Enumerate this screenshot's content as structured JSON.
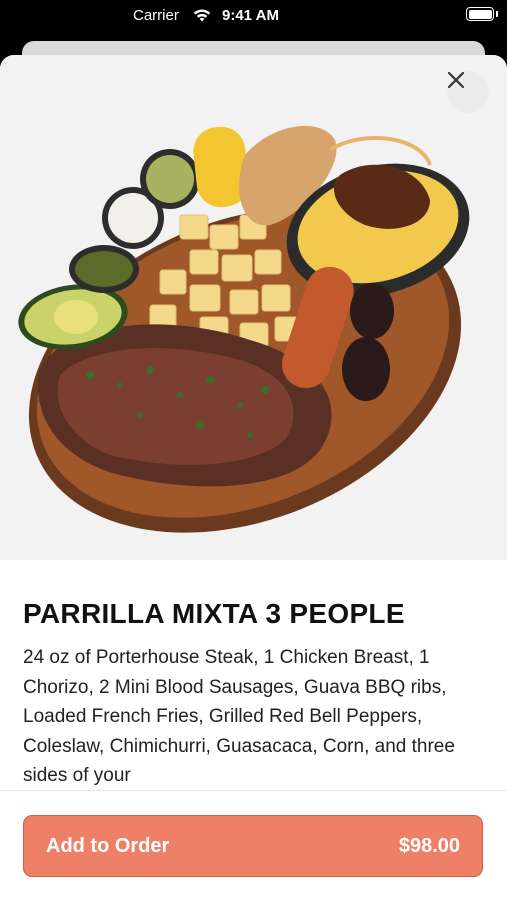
{
  "status_bar": {
    "carrier": "Carrier",
    "time": "9:41 AM"
  },
  "item": {
    "title": "PARRILLA MIXTA 3 PEOPLE",
    "description": "24 oz of Porterhouse Steak, 1 Chicken Breast, 1 Chorizo, 2 Mini Blood Sausages, Guava BBQ ribs, Loaded French Fries, Grilled Red Bell Peppers, Coleslaw, Chimichurri, Guasacaca, Corn, and three sides of your",
    "image_icon": "platter-photo"
  },
  "actions": {
    "close_icon": "close-icon",
    "add_label": "Add to Order",
    "price": "$98.00"
  },
  "colors": {
    "accent": "#ee8068",
    "accent_border": "#d35f48",
    "hero_background": "#f2f2f2"
  }
}
